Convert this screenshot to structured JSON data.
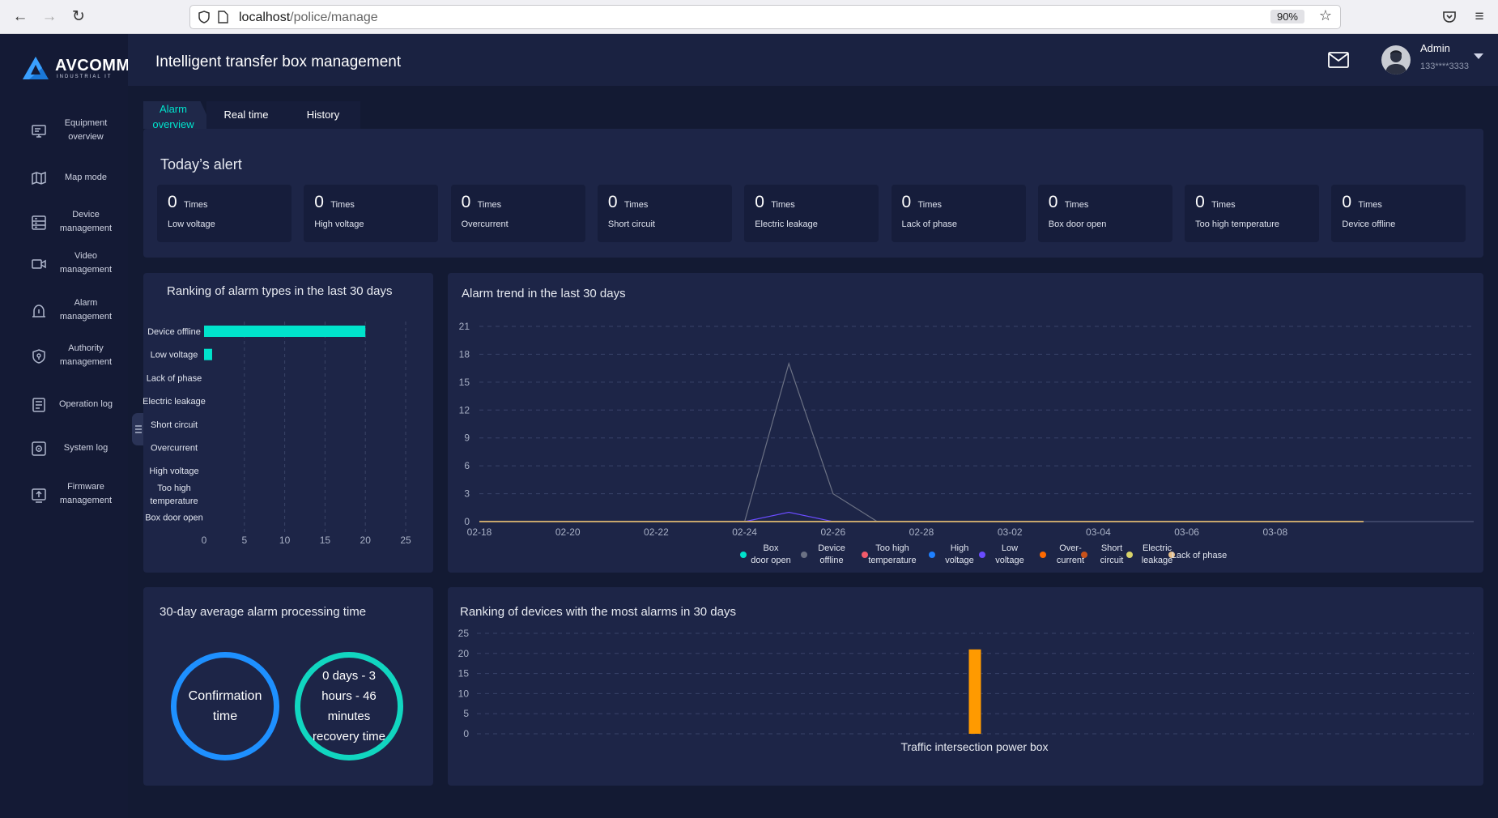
{
  "browser": {
    "url_host": "localhost",
    "url_path": "/police/manage",
    "zoom": "90%"
  },
  "logo": {
    "brand": "AVCOMM",
    "sub": "INDUSTRIAL IT"
  },
  "sidebar": {
    "items": [
      {
        "label": "Equipment overview",
        "icon": "monitor-icon"
      },
      {
        "label": "Map mode",
        "icon": "map-icon"
      },
      {
        "label": "Device management",
        "icon": "server-icon"
      },
      {
        "label": "Video management",
        "icon": "video-icon"
      },
      {
        "label": "Alarm management",
        "icon": "alarm-bell-icon"
      },
      {
        "label": "Authority management",
        "icon": "shield-icon"
      },
      {
        "label": "Operation log",
        "icon": "list-icon"
      },
      {
        "label": "System log",
        "icon": "gear-icon"
      },
      {
        "label": "Firmware management",
        "icon": "upload-icon"
      }
    ]
  },
  "header": {
    "title": "Intelligent transfer box management",
    "user_name": "Admin",
    "user_phone": "133****3333"
  },
  "tabs": [
    {
      "label": "Alarm overview",
      "active": true
    },
    {
      "label": "Real time"
    },
    {
      "label": "History"
    }
  ],
  "today": {
    "title": "Today’s alert",
    "unit": "Times",
    "cards": [
      {
        "value": "0",
        "label": "Low voltage"
      },
      {
        "value": "0",
        "label": "High voltage"
      },
      {
        "value": "0",
        "label": "Overcurrent"
      },
      {
        "value": "0",
        "label": "Short circuit"
      },
      {
        "value": "0",
        "label": "Electric leakage"
      },
      {
        "value": "0",
        "label": "Lack of phase"
      },
      {
        "value": "0",
        "label": "Box door open"
      },
      {
        "value": "0",
        "label": "Too high temperature"
      },
      {
        "value": "0",
        "label": "Device offline"
      }
    ]
  },
  "avg_time": {
    "title": "30-day average alarm processing time",
    "confirmation": "Confirmation time",
    "recovery": "0 days - 3 hours - 46 minutes recovery time"
  },
  "colors": {
    "accent": "#00e3cc",
    "ring_blue": "#1e90ff",
    "bar_orange": "#ff9a00"
  },
  "chart_data": [
    {
      "type": "bar",
      "orientation": "horizontal",
      "title": "Ranking of alarm types in the last 30 days",
      "categories": [
        "Device offline",
        "Low voltage",
        "Lack of phase",
        "Electric leakage",
        "Short circuit",
        "Overcurrent",
        "High voltage",
        "Too high temperature",
        "Box door open"
      ],
      "values": [
        20,
        1,
        0,
        0,
        0,
        0,
        0,
        0,
        0
      ],
      "xlim": [
        0,
        25
      ],
      "ticks": [
        0,
        5,
        10,
        15,
        20,
        25
      ],
      "color": "#00e3cc"
    },
    {
      "type": "line",
      "title": "Alarm trend in the last 30 days",
      "x": [
        "02-18",
        "02-19",
        "02-20",
        "02-21",
        "02-22",
        "02-23",
        "02-24",
        "02-25",
        "02-26",
        "02-27",
        "02-28",
        "03-01",
        "03-02",
        "03-03",
        "03-04",
        "03-05",
        "03-06",
        "03-07",
        "03-08",
        "03-09",
        "03-10"
      ],
      "x_ticks": [
        "02-18",
        "02-20",
        "02-22",
        "02-24",
        "02-26",
        "02-28",
        "03-02",
        "03-04",
        "03-06",
        "03-08"
      ],
      "ylim": [
        0,
        21
      ],
      "y_ticks": [
        0,
        3,
        6,
        9,
        12,
        15,
        18,
        21
      ],
      "series": [
        {
          "name": "Box door open",
          "color": "#00e3cc",
          "values": [
            0,
            0,
            0,
            0,
            0,
            0,
            0,
            0,
            0,
            0,
            0,
            0,
            0,
            0,
            0,
            0,
            0,
            0,
            0,
            0,
            0
          ]
        },
        {
          "name": "Device offline",
          "color": "#6b7184",
          "values": [
            0,
            0,
            0,
            0,
            0,
            0,
            0,
            17,
            3,
            0,
            0,
            0,
            0,
            0,
            0,
            0,
            0,
            0,
            0,
            0,
            0
          ]
        },
        {
          "name": "Too high temperature",
          "color": "#f25a6a",
          "values": [
            0,
            0,
            0,
            0,
            0,
            0,
            0,
            0,
            0,
            0,
            0,
            0,
            0,
            0,
            0,
            0,
            0,
            0,
            0,
            0,
            0
          ]
        },
        {
          "name": "High voltage",
          "color": "#1e80ff",
          "values": [
            0,
            0,
            0,
            0,
            0,
            0,
            0,
            0,
            0,
            0,
            0,
            0,
            0,
            0,
            0,
            0,
            0,
            0,
            0,
            0,
            0
          ]
        },
        {
          "name": "Low voltage",
          "color": "#6a4cff",
          "values": [
            0,
            0,
            0,
            0,
            0,
            0,
            0,
            1,
            0,
            0,
            0,
            0,
            0,
            0,
            0,
            0,
            0,
            0,
            0,
            0,
            0
          ]
        },
        {
          "name": "Over-current",
          "color": "#ff6a00",
          "values": [
            0,
            0,
            0,
            0,
            0,
            0,
            0,
            0,
            0,
            0,
            0,
            0,
            0,
            0,
            0,
            0,
            0,
            0,
            0,
            0,
            0
          ]
        },
        {
          "name": "Short circuit",
          "color": "#c9521a",
          "values": [
            0,
            0,
            0,
            0,
            0,
            0,
            0,
            0,
            0,
            0,
            0,
            0,
            0,
            0,
            0,
            0,
            0,
            0,
            0,
            0,
            0
          ]
        },
        {
          "name": "Electric leakage",
          "color": "#d8d36a",
          "values": [
            0,
            0,
            0,
            0,
            0,
            0,
            0,
            0,
            0,
            0,
            0,
            0,
            0,
            0,
            0,
            0,
            0,
            0,
            0,
            0,
            0
          ]
        },
        {
          "name": "Lack of phase",
          "color": "#e8c08a",
          "values": [
            0,
            0,
            0,
            0,
            0,
            0,
            0,
            0,
            0,
            0,
            0,
            0,
            0,
            0,
            0,
            0,
            0,
            0,
            0,
            0,
            0
          ]
        }
      ],
      "legend": [
        "Box door open",
        "Device offline",
        "Too high temperature",
        "High voltage",
        "Low voltage",
        "Over-current",
        "Short circuit",
        "Electric leakage",
        "Lack of phase"
      ],
      "legend_position": "bottom"
    },
    {
      "type": "bar",
      "title": "Ranking of devices with the most alarms in 30 days",
      "categories": [
        "Traffic intersection power box"
      ],
      "values": [
        21
      ],
      "ylim": [
        0,
        25
      ],
      "y_ticks": [
        0,
        5,
        10,
        15,
        20,
        25
      ],
      "color": "#ff9a00"
    }
  ]
}
